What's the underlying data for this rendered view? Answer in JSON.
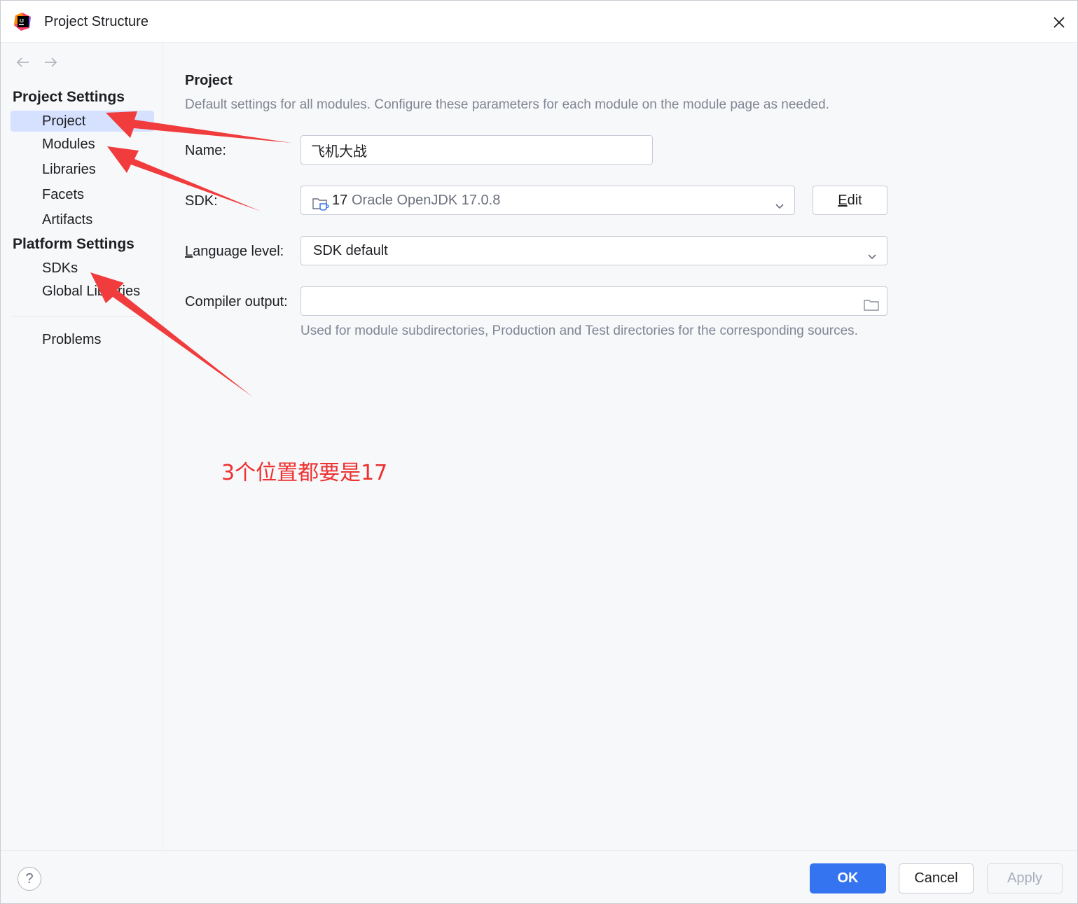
{
  "window": {
    "title": "Project Structure"
  },
  "sidebar": {
    "project_settings_header": "Project Settings",
    "project_items": [
      {
        "label": "Project",
        "selected": true
      },
      {
        "label": "Modules"
      },
      {
        "label": "Libraries"
      },
      {
        "label": "Facets"
      },
      {
        "label": "Artifacts"
      }
    ],
    "platform_settings_header": "Platform Settings",
    "platform_items": [
      {
        "label": "SDKs"
      },
      {
        "label": "Global Libraries"
      }
    ],
    "problems_label": "Problems"
  },
  "main": {
    "title": "Project",
    "description": "Default settings for all modules. Configure these parameters for each module on the module page as needed.",
    "name": {
      "label": "Name:",
      "value": "飞机大战"
    },
    "sdk": {
      "label": "SDK:",
      "version": "17",
      "name": "Oracle OpenJDK 17.0.8",
      "edit_button": "Edit"
    },
    "language_level": {
      "label_prefix": "L",
      "label_rest": "anguage level:",
      "value": "SDK default"
    },
    "compiler_output": {
      "label": "Compiler output:",
      "value": "",
      "hint": "Used for module subdirectories, Production and Test directories for the corresponding sources."
    }
  },
  "annotation": {
    "text": "3个位置都要是17",
    "color": "#ee3030"
  },
  "footer": {
    "help": "?",
    "ok": "OK",
    "cancel": "Cancel",
    "apply": "Apply"
  },
  "colors": {
    "accent": "#3574f0",
    "selection": "#d5e1ff",
    "arrow": "#f03c3c"
  },
  "icons": [
    "intellij-app-icon",
    "close-icon",
    "back-arrow-icon",
    "forward-arrow-icon",
    "jdk-folder-icon",
    "chevron-down-icon",
    "folder-icon",
    "help-icon"
  ]
}
